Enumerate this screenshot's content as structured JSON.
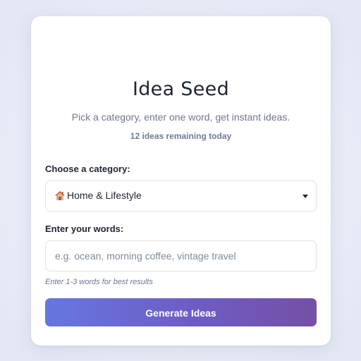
{
  "app": {
    "title": "Idea Seed",
    "subtitle": "Pick a category, enter one word, get instant ideas.",
    "remaining": "12 ideas remaining today"
  },
  "category": {
    "label": "Choose a category:",
    "selected": "Home & Lifestyle",
    "selected_icon": "house-emoji-icon"
  },
  "words": {
    "label": "Enter your words:",
    "value": "",
    "placeholder": "e.g. ocean, morning coffee, vintage travel",
    "hint": "Enter 1-3 words for best results"
  },
  "actions": {
    "generate_label": "Generate Ideas"
  },
  "colors": {
    "button_gradient_start": "#6677e0",
    "button_gradient_end": "#7450a6",
    "title": "#1f2433",
    "muted": "#6b7794"
  }
}
